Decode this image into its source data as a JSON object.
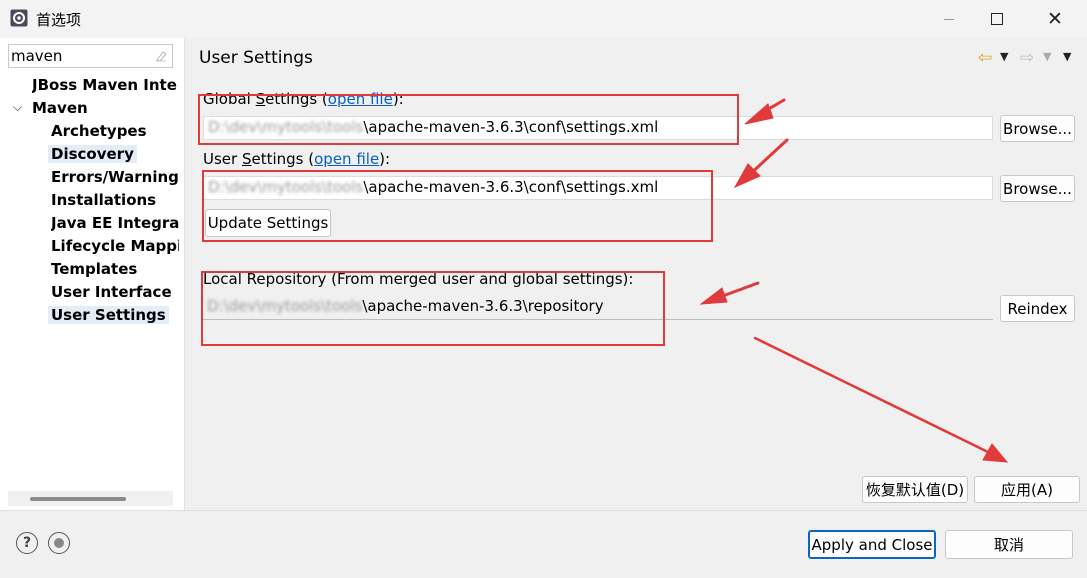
{
  "window": {
    "title": "首选项",
    "icons": {
      "app": "eclipse-icon",
      "minimize": "minimize-icon",
      "maximize": "maximize-icon",
      "close": "close-icon"
    }
  },
  "sidebar": {
    "filter_value": "maven",
    "items": [
      {
        "label": "JBoss Maven Integ",
        "level": 1
      },
      {
        "label": "Maven",
        "level": 1,
        "expanded": true
      },
      {
        "label": "Archetypes",
        "level": 2
      },
      {
        "label": "Discovery",
        "level": 2
      },
      {
        "label": "Errors/Warnings",
        "level": 2
      },
      {
        "label": "Installations",
        "level": 2
      },
      {
        "label": "Java EE Integrati",
        "level": 2
      },
      {
        "label": "Lifecycle Mappir",
        "level": 2
      },
      {
        "label": "Templates",
        "level": 2
      },
      {
        "label": "User Interface",
        "level": 2
      },
      {
        "label": "User Settings",
        "level": 2,
        "selected": true
      }
    ]
  },
  "main": {
    "title": "User Settings",
    "global": {
      "label_pre": "Global ",
      "label_mnemonic": "S",
      "label_post": "ettings (",
      "link": "open file",
      "label_end": "):",
      "path_hidden": "D:\\dev\\mytools\\tools",
      "path_visible": "\\apache-maven-3.6.3\\conf\\settings.xml",
      "browse": "Browse..."
    },
    "user": {
      "label_pre": "User ",
      "label_mnemonic": "S",
      "label_post": "ettings (",
      "link": "open file",
      "label_end": "):",
      "path_hidden": "D:\\dev\\mytools\\tools",
      "path_visible": "\\apache-maven-3.6.3\\conf\\settings.xml",
      "browse": "Browse...",
      "update": "Update Settings"
    },
    "local": {
      "label": "Local Repository (From merged user and global settings):",
      "path_hidden": "D:\\dev\\mytools\\tools",
      "path_visible": "\\apache-maven-3.6.3\\repository",
      "reindex": "Reindex"
    },
    "restore_defaults": "恢复默认值(D)",
    "apply": "应用(A)"
  },
  "footer": {
    "apply_close": "Apply and Close",
    "cancel": "取消"
  },
  "annotation_color": "#e03a3a"
}
